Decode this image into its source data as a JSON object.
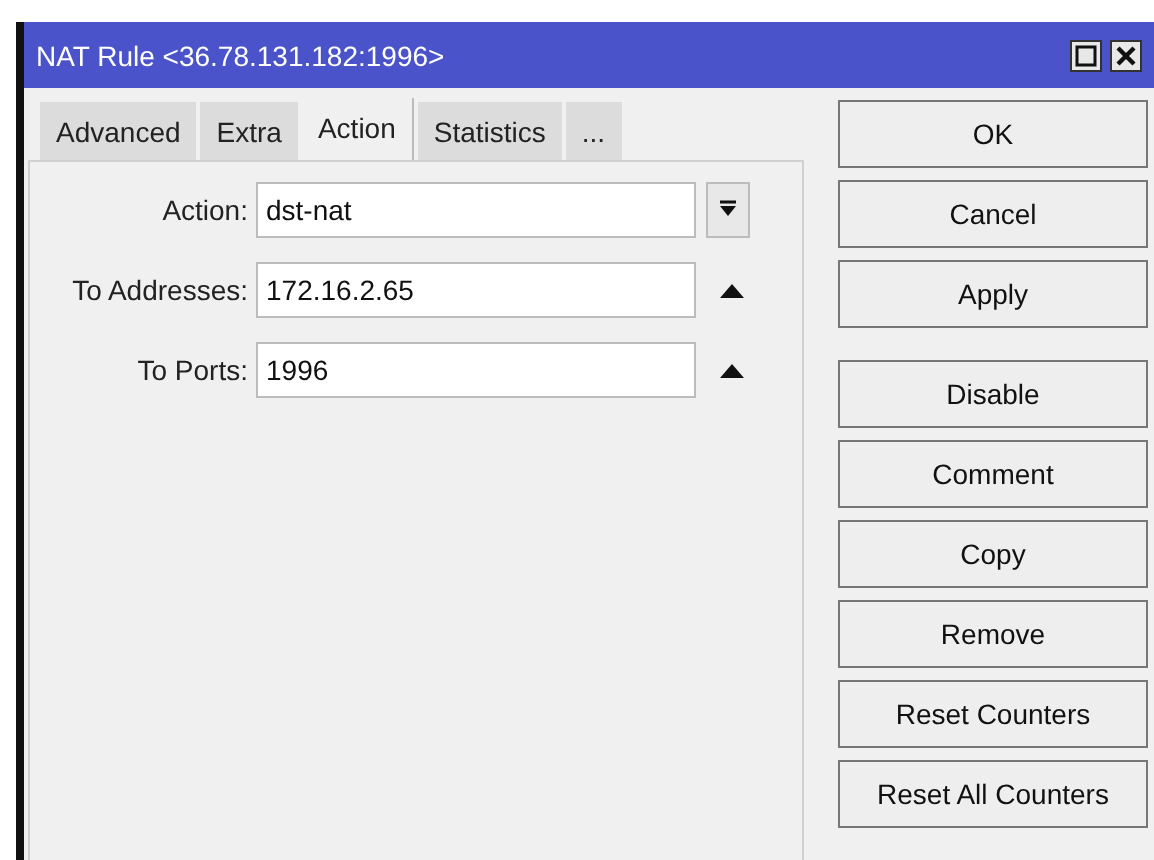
{
  "window": {
    "title": "NAT Rule <36.78.131.182:1996>"
  },
  "tabs": [
    {
      "label": "Advanced",
      "selected": false
    },
    {
      "label": "Extra",
      "selected": false
    },
    {
      "label": "Action",
      "selected": true
    },
    {
      "label": "Statistics",
      "selected": false
    },
    {
      "label": "...",
      "selected": false
    }
  ],
  "fields": [
    {
      "label": "Action:",
      "value": "dst-nat",
      "kind": "dropdown"
    },
    {
      "label": "To Addresses:",
      "value": "172.16.2.65",
      "kind": "collapse"
    },
    {
      "label": "To Ports:",
      "value": "1996",
      "kind": "collapse"
    }
  ],
  "dialog_buttons": [
    "OK",
    "Cancel",
    "Apply"
  ],
  "action_buttons": [
    "Disable",
    "Comment",
    "Copy",
    "Remove",
    "Reset Counters",
    "Reset All Counters"
  ]
}
